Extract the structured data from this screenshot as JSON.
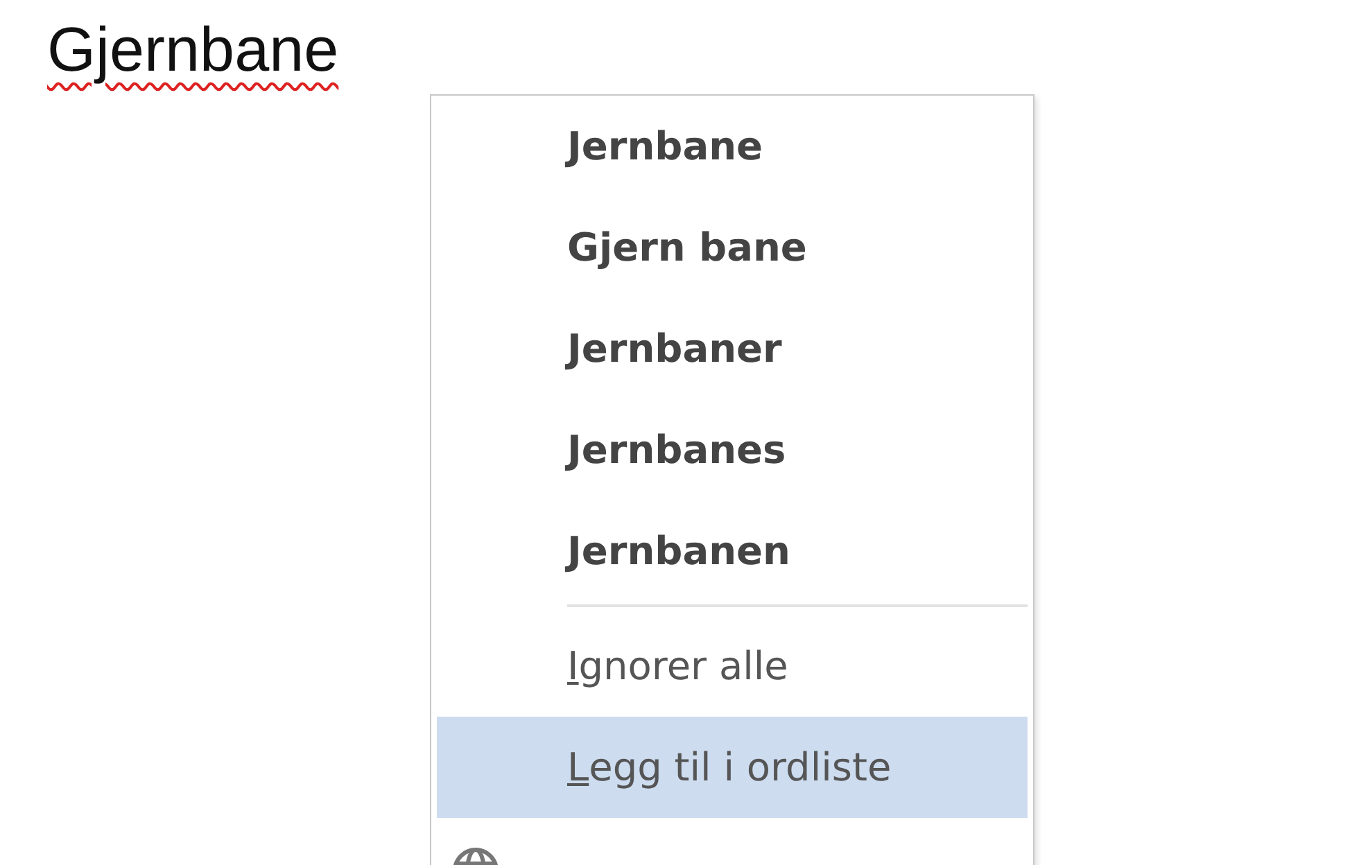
{
  "document": {
    "text": "Gjernbane",
    "misspelled": true
  },
  "context_menu": {
    "suggestions": [
      {
        "label": "Jernbane"
      },
      {
        "label": "Gjern bane"
      },
      {
        "label": "Jernbaner"
      },
      {
        "label": "Jernbanes"
      },
      {
        "label": "Jernbanen"
      }
    ],
    "actions": [
      {
        "kind": "text",
        "key": "I",
        "rest": "gnorer alle",
        "selected": false
      },
      {
        "kind": "text",
        "key": "L",
        "rest": "egg til i ordliste",
        "selected": true
      },
      {
        "kind": "icon-only",
        "selected": false
      }
    ]
  }
}
